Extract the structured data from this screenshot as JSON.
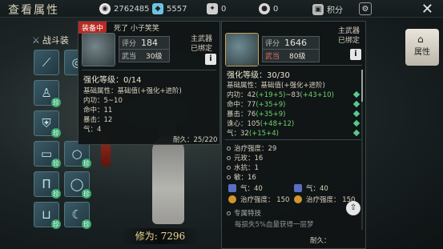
{
  "header": {
    "title": "查看属性",
    "currencies": [
      {
        "icon": "silver-coin-icon",
        "value": "2762485"
      },
      {
        "icon": "gem-icon",
        "value": "5557"
      },
      {
        "icon": "voucher-icon",
        "value": "0"
      },
      {
        "icon": "token-icon",
        "value": "0"
      },
      {
        "icon": "points-icon",
        "label": "积分"
      }
    ]
  },
  "left": {
    "tab_label": "战斗装",
    "slots": [
      {
        "icon": "spear-icon",
        "badge": ""
      },
      {
        "icon": "robe-icon",
        "badge": "珍"
      },
      {
        "icon": "armor-icon",
        "badge": "珍"
      },
      {
        "icon": "belt-icon",
        "badge": "珍"
      },
      {
        "icon": "leggings-icon",
        "badge": "珍"
      },
      {
        "icon": "boots-icon",
        "badge": "珍"
      },
      {
        "icon": "bracelet-icon",
        "badge": ""
      },
      {
        "icon": "ring-icon",
        "badge": "珍"
      },
      {
        "icon": "jade-ring-icon",
        "badge": "珍"
      },
      {
        "icon": "pendant-icon",
        "badge": "珍"
      }
    ],
    "power_label": "修为:",
    "power_value": "7296"
  },
  "equipped_panel": {
    "badge": "装备中",
    "owner_note": "死了 小子笑笑",
    "score_label": "评分",
    "score": "184",
    "realm_label": "武当",
    "realm_value": "30级",
    "slot_type": "主武器",
    "bound": "已绑定",
    "enhance": "强化等级：0/14",
    "base_attr": "基础属性：基础值(+强化+进阶)",
    "stats": [
      "内功：5~10",
      "命中：11",
      "暴击：12",
      "气：4"
    ],
    "durability_label": "耐久：",
    "durability": "25/220"
  },
  "new_panel": {
    "score_label": "评分",
    "score": "1646",
    "realm_label": "武当",
    "realm_value": "80级",
    "slot_type": "主武器",
    "bound": "已绑定",
    "enhance": "强化等级：30/30",
    "base_attr": "基础属性：基础值(+强化+进阶)",
    "stats": [
      {
        "name": "内功：42",
        "bonus": "(+19+5)",
        "tail": "~83",
        "bonus2": "(+43+10)"
      },
      {
        "name": "命中：77",
        "bonus": "(+35+9)"
      },
      {
        "name": "暴击：76",
        "bonus": "(+35+9)"
      },
      {
        "name": "诛心：105",
        "bonus": "(+48+12)"
      },
      {
        "name": "气：32",
        "bonus": "(+15+4)"
      }
    ],
    "extra": [
      "治疗强度：29",
      "元玫：16",
      "水抗：1",
      "敏：16"
    ],
    "sub_stats": [
      {
        "icon": "blue-gem-icon",
        "text": "气：40"
      },
      {
        "icon": "blue-gem-icon",
        "text": "气：40"
      },
      {
        "icon": "gold-gem-icon",
        "text": "治疗强度： 150"
      },
      {
        "icon": "gold-gem-icon",
        "text": "治疗强度： 150"
      }
    ],
    "special_title": "专属特技",
    "special_desc": "每损失5%血量获得一层梦",
    "durability_label": "耐久："
  },
  "attr_tab": {
    "label": "属性"
  }
}
